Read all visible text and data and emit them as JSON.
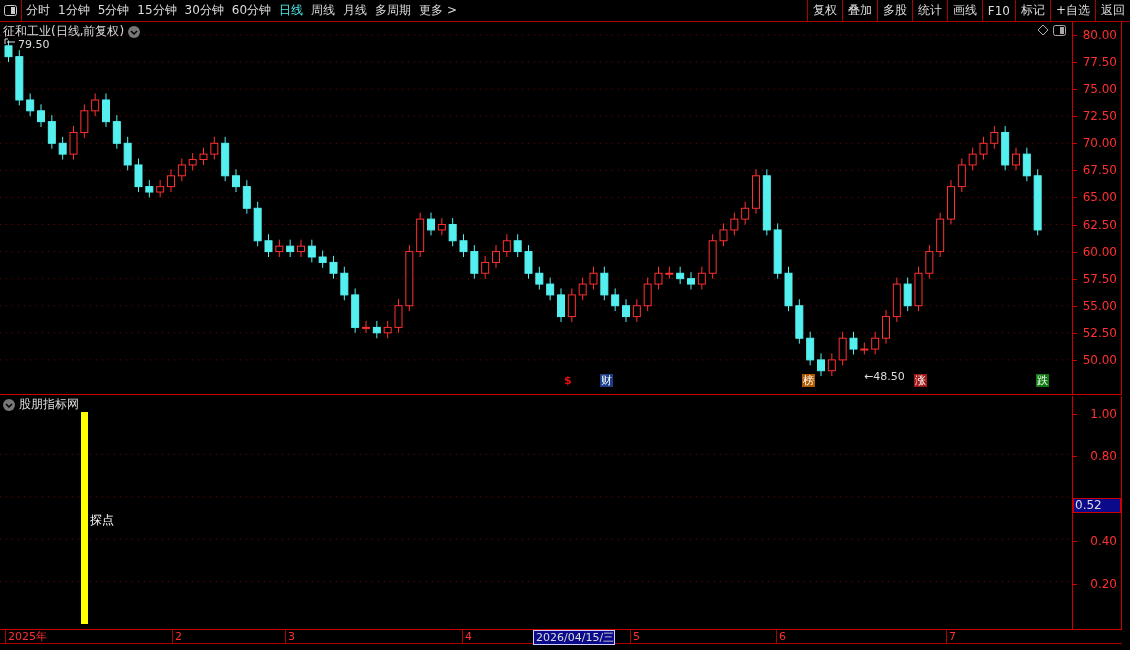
{
  "toolbar": {
    "periods": [
      {
        "label": "分时",
        "selected": false
      },
      {
        "label": "1分钟",
        "selected": false
      },
      {
        "label": "5分钟",
        "selected": false
      },
      {
        "label": "15分钟",
        "selected": false
      },
      {
        "label": "30分钟",
        "selected": false
      },
      {
        "label": "60分钟",
        "selected": false
      },
      {
        "label": "日线",
        "selected": true
      },
      {
        "label": "周线",
        "selected": false
      },
      {
        "label": "月线",
        "selected": false
      },
      {
        "label": "多周期",
        "selected": false
      },
      {
        "label": "更多 >",
        "selected": false
      }
    ],
    "actions": [
      "复权",
      "叠加",
      "多股",
      "统计",
      "画线",
      "F10",
      "标记",
      "+自选",
      "返回"
    ]
  },
  "price_panel": {
    "title": "征和工业(日线,前复权)",
    "high_label": "79.50",
    "low_label": "←48.50",
    "chart_data": {
      "type": "candlestick",
      "ylim": [
        46.85,
        81.2
      ],
      "grid": true,
      "categories": [
        null,
        null,
        null,
        null,
        null,
        null,
        null,
        null,
        null,
        null,
        null,
        null,
        null,
        null,
        null,
        null,
        null,
        null,
        null,
        null,
        null,
        null,
        null,
        null,
        null,
        null,
        null,
        null,
        null,
        null,
        null,
        null,
        null,
        null,
        null,
        null,
        null,
        null,
        null,
        null,
        null,
        null,
        null,
        null,
        null,
        null,
        null,
        null,
        null,
        null,
        null,
        null,
        null,
        null,
        null,
        null,
        null,
        null,
        null,
        null,
        null,
        null,
        null,
        null,
        null,
        null,
        null,
        null,
        null,
        null,
        null,
        null,
        null,
        null,
        null,
        null,
        null,
        null,
        null,
        null,
        null,
        null,
        null,
        null,
        null,
        null,
        null,
        null,
        null,
        null,
        null,
        null,
        null,
        null,
        null,
        null
      ],
      "yticks": [
        {
          "value": 80,
          "label": "80.00"
        },
        {
          "value": 77.5,
          "label": "77.50"
        },
        {
          "value": 75,
          "label": "75.00"
        },
        {
          "value": 72.5,
          "label": "72.50"
        },
        {
          "value": 70,
          "label": "70.00"
        },
        {
          "value": 67.5,
          "label": "67.50"
        },
        {
          "value": 65,
          "label": "65.00"
        },
        {
          "value": 62.5,
          "label": "62.50"
        },
        {
          "value": 60,
          "label": "60.00"
        },
        {
          "value": 57.5,
          "label": "57.50"
        },
        {
          "value": 55,
          "label": "55.00"
        },
        {
          "value": 52.5,
          "label": "52.50"
        },
        {
          "value": 50,
          "label": "50.00"
        }
      ],
      "ohlc": [
        [
          79,
          79.5,
          77.5,
          78
        ],
        [
          78,
          78.6,
          73.5,
          74
        ],
        [
          74,
          74.6,
          72.5,
          73
        ],
        [
          73,
          73.6,
          71.5,
          72
        ],
        [
          72,
          72.6,
          69.5,
          70
        ],
        [
          70,
          70.6,
          68.5,
          69
        ],
        [
          69,
          71.6,
          68.5,
          71
        ],
        [
          71,
          73.6,
          70.5,
          73
        ],
        [
          73,
          74.6,
          72.5,
          74
        ],
        [
          74,
          74.6,
          71.5,
          72
        ],
        [
          72,
          72.6,
          69.5,
          70
        ],
        [
          70,
          70.6,
          67.5,
          68
        ],
        [
          68,
          68.6,
          65.5,
          66
        ],
        [
          66,
          66.6,
          65,
          65.5
        ],
        [
          65.5,
          66.6,
          65,
          66
        ],
        [
          66,
          67.6,
          65.5,
          67
        ],
        [
          67,
          68.6,
          66.5,
          68
        ],
        [
          68,
          69.1,
          67.5,
          68.5
        ],
        [
          68.5,
          69.6,
          68,
          69
        ],
        [
          69,
          70.6,
          68.5,
          70
        ],
        [
          70,
          70.6,
          66.5,
          67
        ],
        [
          67,
          67.6,
          65.5,
          66
        ],
        [
          66,
          66.6,
          63.5,
          64
        ],
        [
          64,
          64.6,
          60.5,
          61
        ],
        [
          61,
          61.6,
          59.5,
          60
        ],
        [
          60,
          61.1,
          59.5,
          60.5
        ],
        [
          60.5,
          61.1,
          59.5,
          60
        ],
        [
          60,
          61.1,
          59.5,
          60.5
        ],
        [
          60.5,
          61.1,
          59,
          59.5
        ],
        [
          59.5,
          60.1,
          58.5,
          59
        ],
        [
          59,
          59.6,
          57.5,
          58
        ],
        [
          58,
          58.6,
          55.5,
          56
        ],
        [
          56,
          56.6,
          52.5,
          53
        ],
        [
          53,
          53.6,
          52.5,
          53
        ],
        [
          53,
          53.6,
          52,
          52.5
        ],
        [
          52.5,
          53.6,
          52,
          53
        ],
        [
          53,
          55.6,
          52.5,
          55
        ],
        [
          55,
          60.6,
          54.5,
          60
        ],
        [
          60,
          63.6,
          59.5,
          63
        ],
        [
          63,
          63.6,
          61.5,
          62
        ],
        [
          62,
          63.1,
          61.5,
          62.5
        ],
        [
          62.5,
          63.1,
          60.5,
          61
        ],
        [
          61,
          61.6,
          59.5,
          60
        ],
        [
          60,
          60.6,
          57.5,
          58
        ],
        [
          58,
          59.6,
          57.5,
          59
        ],
        [
          59,
          60.6,
          58.5,
          60
        ],
        [
          60,
          61.6,
          59.5,
          61
        ],
        [
          61,
          61.6,
          59.5,
          60
        ],
        [
          60,
          60.6,
          57.5,
          58
        ],
        [
          58,
          58.6,
          56.5,
          57
        ],
        [
          57,
          57.6,
          55.5,
          56
        ],
        [
          56,
          56.6,
          53.5,
          54
        ],
        [
          54,
          56.6,
          53.5,
          56
        ],
        [
          56,
          57.6,
          55.5,
          57
        ],
        [
          57,
          58.6,
          56.5,
          58
        ],
        [
          58,
          58.6,
          55.5,
          56
        ],
        [
          56,
          56.6,
          54.5,
          55
        ],
        [
          55,
          55.6,
          53.5,
          54
        ],
        [
          54,
          55.6,
          53.5,
          55
        ],
        [
          55,
          57.6,
          54.5,
          57
        ],
        [
          57,
          58.6,
          56.5,
          58
        ],
        [
          58,
          58.6,
          57.5,
          58
        ],
        [
          58,
          58.6,
          57,
          57.5
        ],
        [
          57.5,
          58.1,
          56.5,
          57
        ],
        [
          57,
          58.6,
          56.5,
          58
        ],
        [
          58,
          61.6,
          57.5,
          61
        ],
        [
          61,
          62.6,
          60.5,
          62
        ],
        [
          62,
          63.6,
          61.5,
          63
        ],
        [
          63,
          64.6,
          62.5,
          64
        ],
        [
          64,
          67.6,
          63.5,
          67
        ],
        [
          67,
          67.6,
          61.5,
          62
        ],
        [
          62,
          62.6,
          57.5,
          58
        ],
        [
          58,
          58.6,
          54.5,
          55
        ],
        [
          55,
          55.6,
          51.5,
          52
        ],
        [
          52,
          52.6,
          49.5,
          50
        ],
        [
          50,
          50.6,
          48.5,
          49
        ],
        [
          49,
          50.6,
          48.5,
          50
        ],
        [
          50,
          52.6,
          49.5,
          52
        ],
        [
          52,
          52.6,
          50.5,
          51
        ],
        [
          51,
          51.6,
          50.5,
          51
        ],
        [
          51,
          52.6,
          50.5,
          52
        ],
        [
          52,
          54.6,
          51.5,
          54
        ],
        [
          54,
          57.6,
          53.5,
          57
        ],
        [
          57,
          57.6,
          54.5,
          55
        ],
        [
          55,
          58.6,
          54.5,
          58
        ],
        [
          58,
          60.6,
          57.5,
          60
        ],
        [
          60,
          63.6,
          59.5,
          63
        ],
        [
          63,
          66.6,
          62.5,
          66
        ],
        [
          66,
          68.6,
          65.5,
          68
        ],
        [
          68,
          69.6,
          67.5,
          69
        ],
        [
          69,
          70.6,
          68.5,
          70
        ],
        [
          70,
          71.6,
          69.5,
          71
        ],
        [
          71,
          71.6,
          67.5,
          68
        ],
        [
          68,
          69.6,
          67.5,
          69
        ],
        [
          69,
          69.6,
          66.5,
          67
        ],
        [
          67,
          67.6,
          61.5,
          62
        ]
      ]
    },
    "events": [
      {
        "label": "$",
        "kind": "text",
        "color": "#e01010"
      },
      {
        "label": "财",
        "kind": "tag",
        "color": "#1c3c8c"
      },
      {
        "label": "榜",
        "kind": "tag",
        "color": "#b05a00"
      },
      {
        "label": "涨",
        "kind": "tag",
        "color": "#a01818"
      },
      {
        "label": "跌",
        "kind": "tag",
        "color": "#107a10"
      }
    ]
  },
  "indicator_panel": {
    "title": "股朋指标网",
    "signal_label": "探点",
    "axis_labels": [
      "1.00",
      "0.80",
      "0.40",
      "0.20"
    ],
    "cursor_value": "0.52"
  },
  "date_axis": [
    {
      "label": "2025年",
      "selected": false
    },
    {
      "label": "2",
      "selected": false
    },
    {
      "label": "3",
      "selected": false
    },
    {
      "label": "4",
      "selected": false
    },
    {
      "label": "2026/04/15/三",
      "selected": true
    },
    {
      "label": "5",
      "selected": false
    },
    {
      "label": "6",
      "selected": false
    },
    {
      "label": "7",
      "selected": false
    }
  ]
}
